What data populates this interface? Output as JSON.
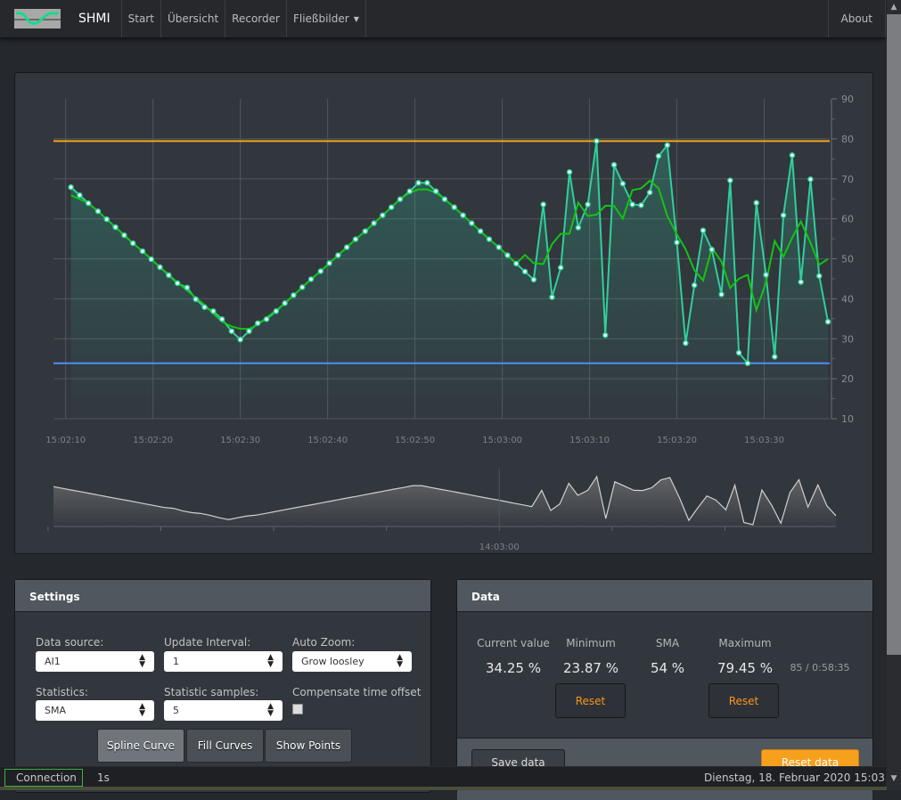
{
  "navbar": {
    "brand": "SHMI",
    "items": [
      "Start",
      "Übersicht",
      "Recorder",
      "Fließbilder"
    ],
    "about": "About"
  },
  "colors": {
    "raw": "#2fcf9a",
    "sma": "#12c412",
    "max_line": "#f5a31a",
    "min_line": "#4f8ef5",
    "accent": "#f7941d",
    "connection": "#3cb043"
  },
  "chart_data": {
    "type": "line",
    "xlim": [
      "15:02:08.6",
      "15:03:37.5"
    ],
    "ylim": [
      10,
      90
    ],
    "yticks": [
      10,
      20,
      30,
      40,
      50,
      60,
      70,
      80,
      90
    ],
    "xticks": [
      "15:02:10",
      "15:02:20",
      "15:02:30",
      "15:02:40",
      "15:02:50",
      "15:03:00",
      "15:03:10",
      "15:03:20",
      "15:03:30"
    ],
    "grid": true,
    "x": [
      "15:02:10.6",
      "15:02:11.6",
      "15:02:12.6",
      "15:02:13.7",
      "15:02:14.7",
      "15:02:15.7",
      "15:02:16.7",
      "15:02:17.7",
      "15:02:18.8",
      "15:02:19.8",
      "15:02:20.8",
      "15:02:21.8",
      "15:02:22.8",
      "15:02:23.9",
      "15:02:24.9",
      "15:02:25.9",
      "15:02:26.9",
      "15:02:27.9",
      "15:02:29.0",
      "15:02:30.0",
      "15:02:31.0",
      "15:02:32.0",
      "15:02:33.0",
      "15:02:34.1",
      "15:02:35.1",
      "15:02:36.1",
      "15:02:37.1",
      "15:02:38.1",
      "15:02:39.2",
      "15:02:40.2",
      "15:02:41.2",
      "15:02:42.2",
      "15:02:43.2",
      "15:02:44.3",
      "15:02:45.3",
      "15:02:46.3",
      "15:02:47.3",
      "15:02:48.3",
      "15:02:49.4",
      "15:02:50.4",
      "15:02:51.4",
      "15:02:52.4",
      "15:02:53.4",
      "15:02:54.5",
      "15:02:55.5",
      "15:02:56.5",
      "15:02:57.5",
      "15:02:58.5",
      "15:02:59.6",
      "15:03:00.6",
      "15:03:01.6",
      "15:03:02.6",
      "15:03:03.6",
      "15:03:04.7",
      "15:03:05.7",
      "15:03:06.7",
      "15:03:07.7",
      "15:03:08.7",
      "15:03:09.8",
      "15:03:10.8",
      "15:03:11.8",
      "15:03:12.8",
      "15:03:13.8",
      "15:03:14.9",
      "15:03:15.9",
      "15:03:16.9",
      "15:03:17.9",
      "15:03:18.9",
      "15:03:20.0",
      "15:03:21.0",
      "15:03:22.0",
      "15:03:23.0",
      "15:03:24.0",
      "15:03:25.1",
      "15:03:26.1",
      "15:03:27.1",
      "15:03:28.1",
      "15:03:29.1",
      "15:03:30.2",
      "15:03:31.2",
      "15:03:32.2",
      "15:03:33.2",
      "15:03:34.2",
      "15:03:35.3",
      "15:03:36.3",
      "15:03:37.3"
    ],
    "series": [
      {
        "values": [
          67.9,
          65.9,
          63.9,
          61.9,
          59.9,
          57.9,
          55.9,
          53.9,
          51.9,
          49.9,
          47.9,
          45.9,
          43.9,
          42.8,
          39.9,
          37.9,
          36.9,
          34.9,
          31.9,
          29.8,
          31.9,
          33.9,
          34.9,
          36.9,
          38.9,
          40.9,
          42.9,
          44.9,
          46.9,
          48.9,
          50.9,
          52.9,
          54.9,
          56.9,
          58.9,
          60.9,
          62.9,
          64.9,
          66.9,
          69.0,
          69.0,
          66.9,
          64.9,
          62.9,
          60.9,
          58.9,
          56.9,
          54.9,
          52.9,
          50.9,
          48.8,
          46.8,
          44.8,
          63.6,
          40.4,
          47.8,
          71.7,
          57.8,
          63.6,
          79.45,
          30.9,
          73.5,
          68.8,
          63.6,
          63.4,
          66.6,
          75.7,
          78.4,
          54.1,
          28.9,
          43.4,
          57.1,
          52.3,
          41.1,
          69.6,
          26.5,
          23.87,
          64.0,
          46.0,
          25.5,
          60.9,
          75.9,
          44.2,
          69.9,
          45.7,
          34.25
        ]
      },
      {
        "statistic": "SMA",
        "samples": 5
      }
    ],
    "hlines": {
      "max": 79.45,
      "min": 23.87
    },
    "navigator": {
      "label": "14:03:00",
      "label_time": "15:03:00"
    }
  },
  "settings": {
    "title": "Settings",
    "data_source_label": "Data source:",
    "data_source": "AI1",
    "update_interval_label": "Update Interval:",
    "update_interval": "1",
    "auto_zoom_label": "Auto Zoom:",
    "auto_zoom": "Grow loosley",
    "statistics_label": "Statistics:",
    "statistics": "SMA",
    "samples_label": "Statistic samples:",
    "samples": "5",
    "compensate_label": "Compensate time offset",
    "compensate": false,
    "buttons": [
      "Spline Curve",
      "Fill Curves",
      "Show Points"
    ]
  },
  "data": {
    "title": "Data",
    "current_label": "Current value",
    "current": "34.25 %",
    "min_label": "Minimum",
    "min": "23.87 %",
    "sma_label": "SMA",
    "sma": "54 %",
    "max_label": "Maximum",
    "max": "79.45 %",
    "count": "85 / 0:58:35",
    "reset": "Reset",
    "save": "Save data",
    "reset_data": "Reset data"
  },
  "status": {
    "connection": "Connection",
    "interval": "1s",
    "datetime": "Dienstag, 18. Februar 2020 15:03"
  }
}
